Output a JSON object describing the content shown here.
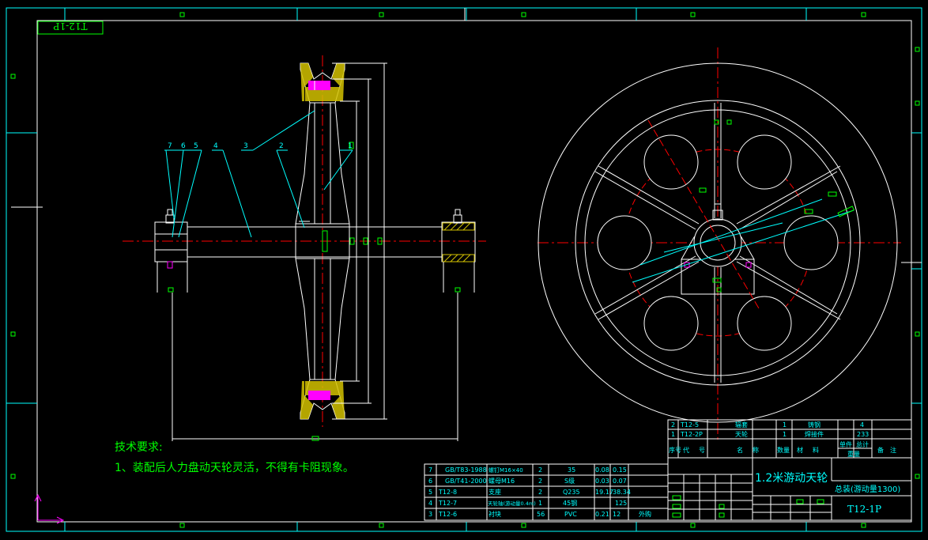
{
  "drawing": {
    "code_mirrored": "T12-1P",
    "title": "1.2米游动天轮",
    "assembly": "总装(游动量1300)",
    "code": "T12-1P"
  },
  "tech_requirements": {
    "heading": "技术要求:",
    "item1": "1、装配后人力盘动天轮灵活，不得有卡阻现象。"
  },
  "balloons": [
    "7",
    "6",
    "5",
    "4",
    "3",
    "2",
    "1"
  ],
  "parts_upper": [
    {
      "no": "2",
      "code": "T12-5",
      "name": "辐套",
      "qty": "1",
      "material": "铸钢",
      "weight": "4"
    },
    {
      "no": "1",
      "code": "T12-2P",
      "name": "天轮",
      "qty": "1",
      "material": "焊接件",
      "weight": "233"
    }
  ],
  "header_labels": {
    "seq": "序号",
    "code": "代号",
    "name": "名称",
    "qty": "数量",
    "material": "材料",
    "unit_weight": "单件",
    "total_weight": "总计",
    "weight": "重量",
    "remark": "备注"
  },
  "parts_lower": [
    {
      "no": "7",
      "code": "GB/T83-1988",
      "name": "螺钉M16×40",
      "qty": "2",
      "material": "35",
      "w1": "0.08",
      "w2": "0.15"
    },
    {
      "no": "6",
      "code": "GB/T41-2000",
      "name": "螺母M16",
      "qty": "2",
      "material": "S级",
      "w1": "0.03",
      "w2": "0.07"
    },
    {
      "no": "5",
      "code": "T12-8",
      "name": "支座",
      "qty": "2",
      "material": "Q235",
      "w1": "19.17",
      "w2": "38.34"
    },
    {
      "no": "4",
      "code": "T12-7",
      "name": "天轮轴(游动量0.4m)",
      "qty": "1",
      "material": "45钢",
      "w1": "",
      "w2": "125"
    },
    {
      "no": "3",
      "code": "T12-6",
      "name": "衬块",
      "qty": "56",
      "material": "PVC",
      "w1": "0.21",
      "w2": "12",
      "remark": "外购"
    }
  ],
  "colors": {
    "frame": "#ffffff",
    "cyan": "#00ffff",
    "green": "#00ff00",
    "yellow": "#ffff00",
    "magenta": "#ff00ff",
    "red": "#ff0000",
    "hatch": "#d4c200"
  }
}
